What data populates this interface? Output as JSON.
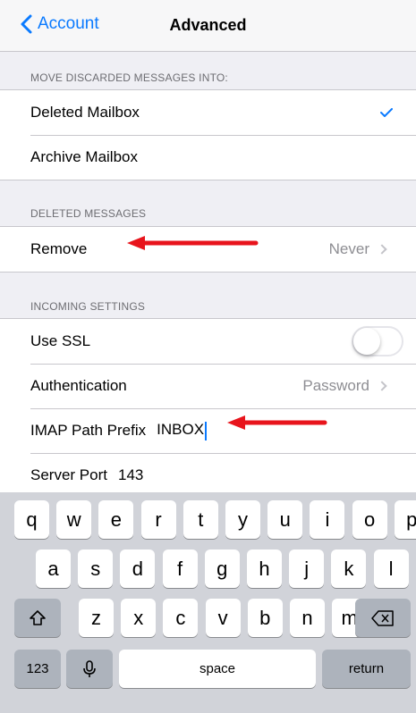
{
  "nav": {
    "back_label": "Account",
    "title": "Advanced"
  },
  "sections": {
    "move_discarded": {
      "header": "MOVE DISCARDED MESSAGES INTO:",
      "rows": [
        {
          "label": "Deleted Mailbox",
          "selected": true
        },
        {
          "label": "Archive Mailbox",
          "selected": false
        }
      ]
    },
    "deleted_messages": {
      "header": "DELETED MESSAGES",
      "remove": {
        "label": "Remove",
        "value": "Never"
      }
    },
    "incoming": {
      "header": "INCOMING SETTINGS",
      "use_ssl": {
        "label": "Use SSL",
        "on": false
      },
      "authentication": {
        "label": "Authentication",
        "value": "Password"
      },
      "imap_prefix": {
        "label": "IMAP Path Prefix",
        "value": "INBOX"
      },
      "server_port": {
        "label": "Server Port",
        "value": "143"
      }
    }
  },
  "keyboard": {
    "row1": [
      "q",
      "w",
      "e",
      "r",
      "t",
      "y",
      "u",
      "i",
      "o",
      "p"
    ],
    "row2": [
      "a",
      "s",
      "d",
      "f",
      "g",
      "h",
      "j",
      "k",
      "l"
    ],
    "row3": [
      "z",
      "x",
      "c",
      "v",
      "b",
      "n",
      "m"
    ],
    "numbers_label": "123",
    "space_label": "space",
    "return_label": "return"
  },
  "colors": {
    "tint": "#0a7aff",
    "annotation_arrow": "#e8141c",
    "separator": "#c8c7cc",
    "background": "#efeff4"
  }
}
